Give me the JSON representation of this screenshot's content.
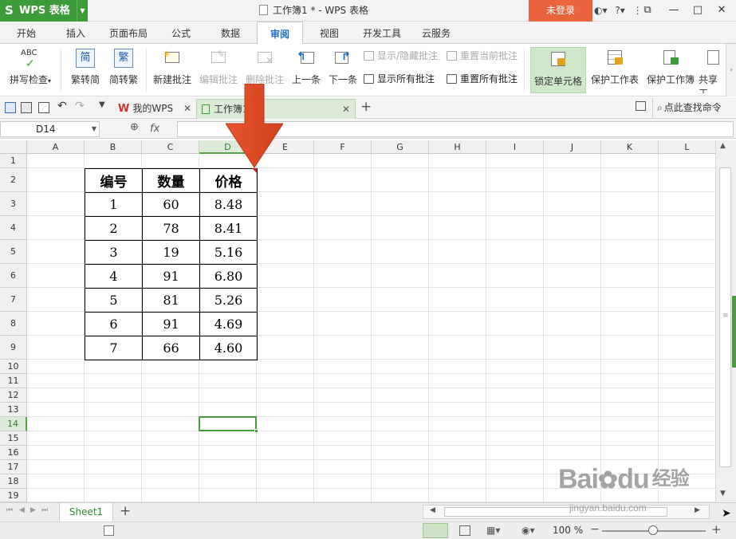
{
  "app": {
    "name": "WPS 表格",
    "doc_title": "工作簿1 * - WPS 表格",
    "login": "未登录",
    "accent": "#3d9b3a"
  },
  "ribbon_tabs": [
    "开始",
    "插入",
    "页面布局",
    "公式",
    "数据",
    "审阅",
    "视图",
    "开发工具",
    "云服务"
  ],
  "active_tab": "审阅",
  "ribbon": {
    "spellcheck": "拼写检查",
    "trad_to_simp": "繁转简",
    "simp_to_trad": "简转繁",
    "new_comment": "新建批注",
    "edit_comment": "编辑批注",
    "delete_comment": "删除批注",
    "prev": "上一条",
    "next": "下一条",
    "show_hide_comment": "显示/隐藏批注",
    "show_all_comments": "显示所有批注",
    "reset_current_comment": "重置当前批注",
    "reset_all_comments": "重置所有批注",
    "lock_cell": "锁定单元格",
    "protect_sheet": "保护工作表",
    "protect_workbook": "保护工作簿",
    "share": "共享工",
    "abc": "ABC",
    "simp_char": "简",
    "trad_char": "繁"
  },
  "doc_tabs": [
    "我的WPS",
    "工作簿1"
  ],
  "search_cmd": "点此查找命令",
  "formula": {
    "name_box": "D14",
    "fx": "fx",
    "value": ""
  },
  "columns": [
    "A",
    "B",
    "C",
    "D",
    "E",
    "F",
    "G",
    "H",
    "I",
    "J",
    "K",
    "L"
  ],
  "rows": [
    "1",
    "2",
    "3",
    "4",
    "5",
    "6",
    "7",
    "8",
    "9",
    "10",
    "11",
    "12",
    "13",
    "14",
    "15",
    "16",
    "17",
    "18",
    "19"
  ],
  "selected": {
    "column": "D",
    "row": "14"
  },
  "table": {
    "headers": [
      "编号",
      "数量",
      "价格"
    ],
    "rows": [
      [
        "1",
        "60",
        "8.48"
      ],
      [
        "2",
        "78",
        "8.41"
      ],
      [
        "3",
        "19",
        "5.16"
      ],
      [
        "4",
        "91",
        "6.80"
      ],
      [
        "5",
        "81",
        "5.26"
      ],
      [
        "6",
        "91",
        "4.69"
      ],
      [
        "7",
        "66",
        "4.60"
      ]
    ]
  },
  "sheets": [
    "Sheet1"
  ],
  "status": {
    "zoom": "100 %"
  },
  "watermark": {
    "brand": "Bai",
    "brand2": "du",
    "cn": "经验",
    "url": "jingyan.baidu.com"
  }
}
